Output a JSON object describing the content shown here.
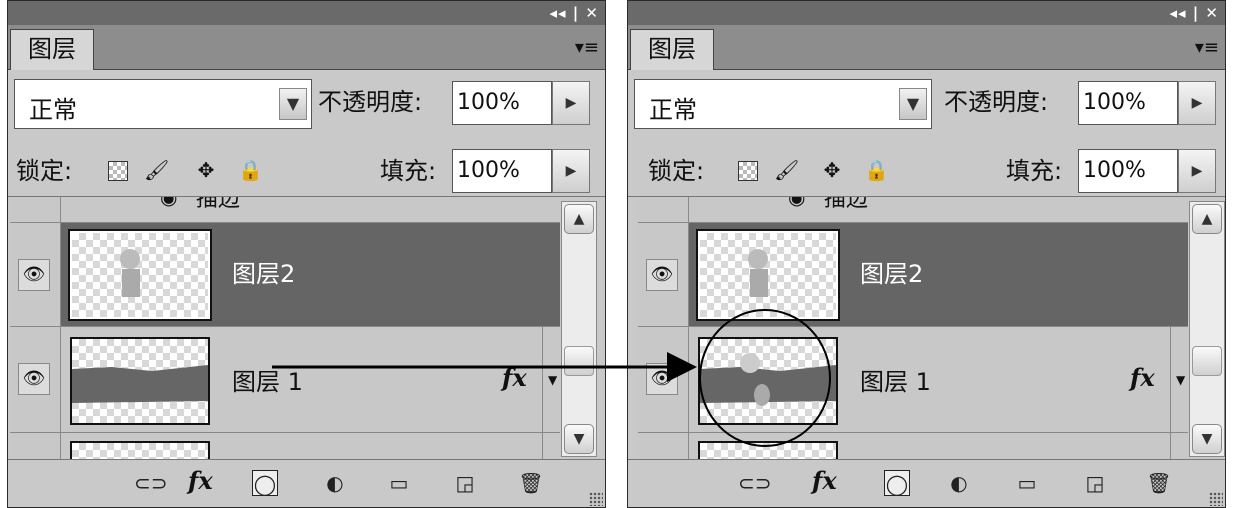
{
  "panels": {
    "left": {
      "window_controls": "◂◂ | ✕",
      "tab_label": "图层",
      "menu_icon": "panel-menu-icon",
      "blend_mode": "正常",
      "opacity_label": "不透明度:",
      "opacity_value": "100%",
      "lock_label": "锁定:",
      "fill_label": "填充:",
      "fill_value": "100%",
      "partial_layer_label": "描边",
      "layers": [
        {
          "name": "图层2",
          "selected": true,
          "has_fx": false
        },
        {
          "name": "图层 1",
          "selected": false,
          "has_fx": true,
          "fx_label": "fx"
        }
      ]
    },
    "right": {
      "window_controls": "◂◂ | ✕",
      "tab_label": "图层",
      "menu_icon": "panel-menu-icon",
      "blend_mode": "正常",
      "opacity_label": "不透明度:",
      "opacity_value": "100%",
      "lock_label": "锁定:",
      "fill_label": "填充:",
      "fill_value": "100%",
      "partial_layer_label": "描边",
      "layers": [
        {
          "name": "图层2",
          "selected": true,
          "has_fx": false
        },
        {
          "name": "图层 1",
          "selected": false,
          "has_fx": true,
          "fx_label": "fx"
        }
      ]
    }
  },
  "bottom_icons": [
    "link-layers-icon",
    "fx-icon",
    "add-mask-icon",
    "adjustment-layer-icon",
    "new-group-icon",
    "new-layer-icon",
    "trash-icon"
  ],
  "bottom_fx_label": "fx",
  "colors": {
    "selected_row": "#656565",
    "panel_bg": "#c9c9c9",
    "layer_fill": "#666666"
  }
}
